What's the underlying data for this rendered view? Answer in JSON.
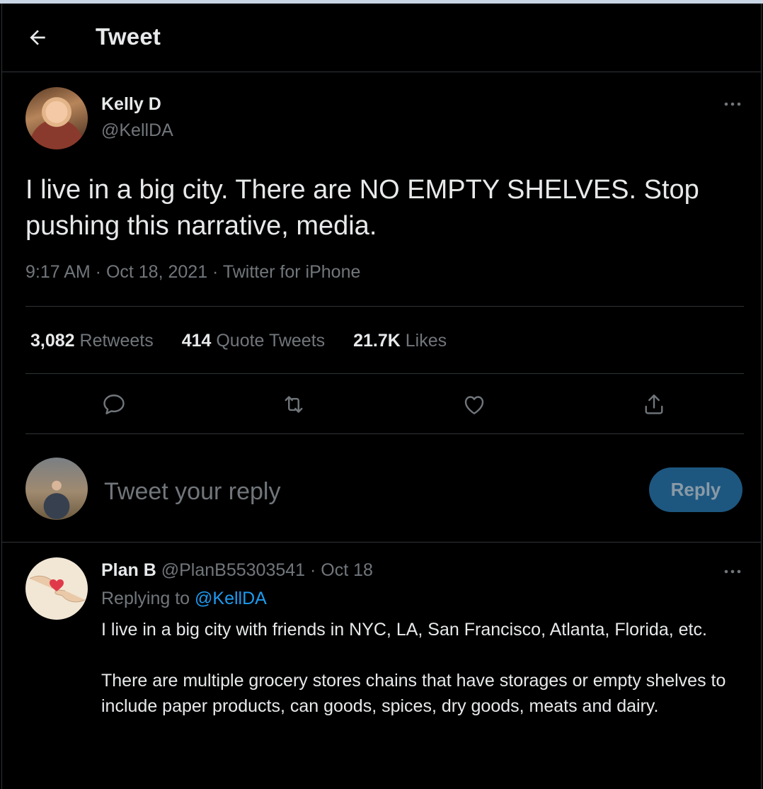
{
  "header": {
    "title": "Tweet"
  },
  "tweet": {
    "author_name": "Kelly D",
    "author_handle": "@KellDA",
    "text": "I live in a big city. There are NO EMPTY SHELVES. Stop pushing this narrative, media.",
    "meta": "9:17 AM · Oct 18, 2021 · Twitter for iPhone",
    "stats": {
      "retweets_count": "3,082",
      "retweets_label": "Retweets",
      "quotes_count": "414",
      "quotes_label": "Quote Tweets",
      "likes_count": "21.7K",
      "likes_label": "Likes"
    }
  },
  "composer": {
    "placeholder": "Tweet your reply",
    "button_label": "Reply"
  },
  "reply": {
    "author_name": "Plan B",
    "author_handle": "@PlanB55303541",
    "date": "· Oct 18",
    "replying_prefix": "Replying to",
    "replying_handle": "@KellDA",
    "paragraph_1": "I live in a big city with friends in NYC, LA, San Francisco, Atlanta, Florida, etc.",
    "paragraph_2": "There are multiple grocery stores chains that have storages or empty shelves to include paper products,  can goods, spices, dry goods, meats and dairy."
  },
  "colors": {
    "accent": "#1d9bf0",
    "muted": "#71767b",
    "background": "#000000",
    "reply_button": "#1d5780"
  },
  "icons": [
    "back-arrow-icon",
    "more-icon",
    "reply-icon",
    "retweet-icon",
    "like-icon",
    "share-icon"
  ]
}
